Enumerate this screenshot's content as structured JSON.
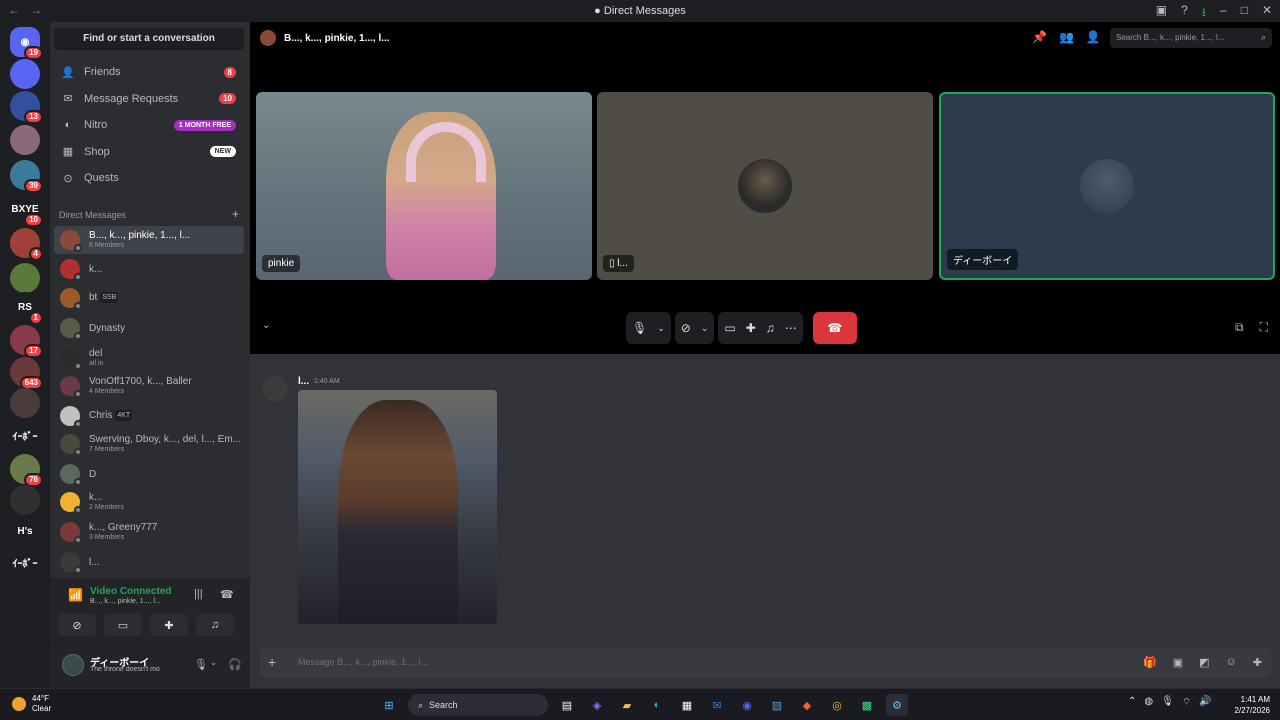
{
  "titlebar": {
    "title": "Direct Messages",
    "back": "←",
    "forward": "→"
  },
  "server_rail": {
    "home_badge": "19",
    "servers": [
      {
        "label": "",
        "badge": "",
        "color": "#5865f2"
      },
      {
        "label": "",
        "badge": "13",
        "color": "#3050a0"
      },
      {
        "label": "",
        "badge": "",
        "color": "#8a6a7a"
      },
      {
        "label": "",
        "badge": "39",
        "color": "#3a7a9a"
      },
      {
        "label": "BXYE",
        "badge": "10",
        "color": "#1e1f22"
      },
      {
        "label": "",
        "badge": "4",
        "color": "#a0403a"
      },
      {
        "label": "",
        "badge": "",
        "color": "#5a7a3a"
      },
      {
        "label": "RS",
        "badge": "1",
        "color": "#1e1f22"
      },
      {
        "label": "",
        "badge": "17",
        "color": "#8a3a4a"
      },
      {
        "label": "",
        "badge": "643",
        "color": "#6a3a3a"
      },
      {
        "label": "",
        "badge": "",
        "color": "#4a3a3a"
      },
      {
        "label": "ｲｰﾎﾞｰ",
        "badge": "",
        "color": "#1e1f22"
      },
      {
        "label": "",
        "badge": "76",
        "color": "#6a7a4a"
      },
      {
        "label": "",
        "badge": "",
        "color": "#303030"
      },
      {
        "label": "H's",
        "badge": "",
        "color": "#1e1f22"
      },
      {
        "label": "ｲｰﾎﾞｰ",
        "badge": "",
        "color": "#1e1f22"
      }
    ]
  },
  "sidebar": {
    "find": "Find or start a conversation",
    "nav": [
      {
        "label": "Friends",
        "icon": "friends-icon",
        "badge": "8",
        "kind": "count"
      },
      {
        "label": "Message Requests",
        "icon": "envelope-icon",
        "badge": "10",
        "kind": "count"
      },
      {
        "label": "Nitro",
        "icon": "nitro-icon",
        "badge": "1 MONTH FREE",
        "kind": "nitro"
      },
      {
        "label": "Shop",
        "icon": "shop-icon",
        "badge": "NEW",
        "kind": "new"
      },
      {
        "label": "Quests",
        "icon": "quests-icon",
        "badge": "",
        "kind": ""
      }
    ],
    "dm_header": "Direct Messages",
    "dms": [
      {
        "name": "B..., k..., pinkie, 1..., l...",
        "sub": "6 Members",
        "tag": "",
        "color": "#8a4a3a",
        "active": true
      },
      {
        "name": "k...",
        "sub": "",
        "tag": "",
        "color": "#b03030",
        "active": false
      },
      {
        "name": "bt",
        "sub": "",
        "tag": "SSB",
        "color": "#9a5a2a",
        "active": false
      },
      {
        "name": "Dynasty",
        "sub": "",
        "tag": "",
        "color": "#5a5a4a",
        "active": false
      },
      {
        "name": "del",
        "sub": "all in",
        "tag": "",
        "color": "#2a2a2a",
        "active": false
      },
      {
        "name": "VonOff1700, k..., Baller",
        "sub": "4 Members",
        "tag": "",
        "color": "#6a3a4a",
        "active": false
      },
      {
        "name": "Chris",
        "sub": "",
        "tag": "4KT",
        "color": "#c0c0c0",
        "active": false
      },
      {
        "name": "Swerving, Dboy, k..., del, l..., Em...",
        "sub": "7 Members",
        "tag": "",
        "color": "#4a4a3a",
        "active": false
      },
      {
        "name": "D",
        "sub": "",
        "tag": "",
        "color": "#5a6a5a",
        "active": false
      },
      {
        "name": "k...",
        "sub": "2 Members",
        "tag": "",
        "color": "#f0b232",
        "active": false
      },
      {
        "name": "k..., Greeny777",
        "sub": "3 Members",
        "tag": "",
        "color": "#7a3a3a",
        "active": false
      },
      {
        "name": "l...",
        "sub": "",
        "tag": "",
        "color": "#3a3a3a",
        "active": false
      }
    ]
  },
  "voice": {
    "status": "Video Connected",
    "channel": "B..., k..., pinkie, 1..., l..."
  },
  "user": {
    "name": "ディーボーイ",
    "status": "The throne doesn't mo"
  },
  "call": {
    "group_name": "B..., k..., pinkie, 1..., l...",
    "search_placeholder": "Search B..., k..., pinkie, 1..., l...",
    "tiles": [
      {
        "label": "pinkie"
      },
      {
        "label": "l..."
      },
      {
        "label": "ディーボーイ"
      }
    ]
  },
  "message": {
    "author": "l...",
    "time": "1:40 AM"
  },
  "composer": {
    "placeholder": "Message B..., k..., pinkie, 1..., l..."
  },
  "taskbar": {
    "temp": "44°F",
    "condition": "Clear",
    "search": "Search",
    "time": "1:41 AM",
    "date": "2/27/2026"
  },
  "colors": {
    "accent": "#5865f2",
    "connected": "#23a55a",
    "danger": "#da373c",
    "badge": "#f23f43"
  }
}
